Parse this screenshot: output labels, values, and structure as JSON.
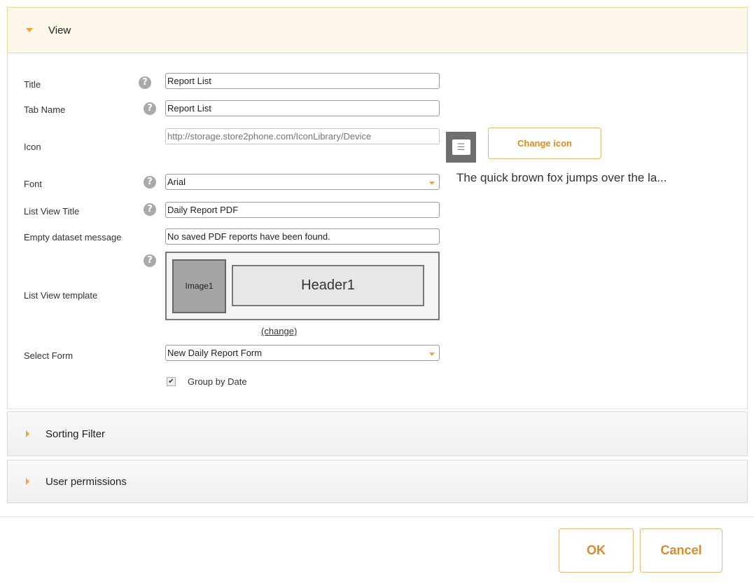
{
  "sections": {
    "view": {
      "title": "View"
    },
    "sorting": {
      "title": "Sorting Filter"
    },
    "permissions": {
      "title": "User permissions"
    }
  },
  "form": {
    "title": {
      "label": "Title",
      "value": "Report List"
    },
    "tab_name": {
      "label": "Tab Name",
      "value": "Report List"
    },
    "icon": {
      "label": "Icon",
      "value": "http://storage.store2phone.com/IconLibrary/Device",
      "button": "Change icon"
    },
    "font": {
      "label": "Font",
      "value": "Arial",
      "preview": "The quick brown fox jumps over the la..."
    },
    "list_view_title": {
      "label": "List View Title",
      "value": "Daily Report PDF"
    },
    "empty_message": {
      "label": "Empty dataset message",
      "value": "No saved PDF reports have been found."
    },
    "template": {
      "label": "List View template",
      "image_label": "Image1",
      "header_label": "Header1",
      "change_link": "(change)"
    },
    "select_form": {
      "label": "Select Form",
      "value": "New Daily Report Form"
    },
    "group_by_date": {
      "label": "Group by Date",
      "checked": true
    }
  },
  "help_icon_glyph": "?",
  "footer": {
    "ok": "OK",
    "cancel": "Cancel"
  },
  "colors": {
    "accent": "#f2a33a",
    "button_text": "#e08a1e",
    "active_header_bg": "#fdf8ea"
  }
}
